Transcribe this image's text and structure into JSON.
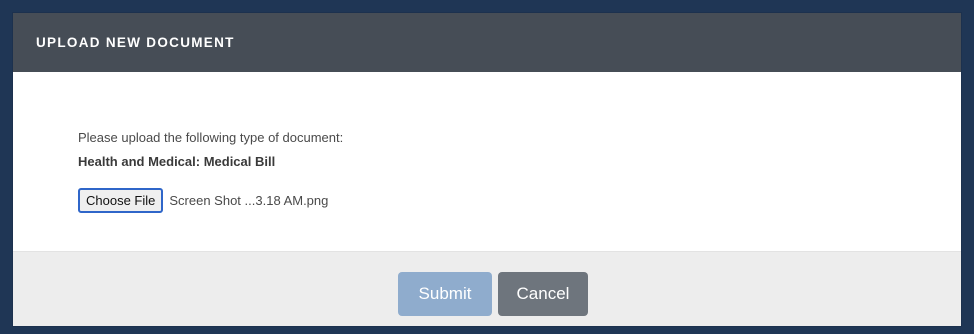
{
  "modal": {
    "title": "UPLOAD NEW DOCUMENT",
    "instruction": "Please upload the following type of document:",
    "document_type": "Health and Medical: Medical Bill",
    "file_input": {
      "button_label": "Choose File",
      "file_name": "Screen Shot ...3.18 AM.png"
    },
    "footer": {
      "submit_label": "Submit",
      "cancel_label": "Cancel"
    }
  },
  "colors": {
    "header_bg": "#464d56",
    "page_bg": "#1f3655",
    "submit_bg": "#8faccd",
    "cancel_bg": "#6e757d",
    "footer_bg": "#ededed"
  }
}
